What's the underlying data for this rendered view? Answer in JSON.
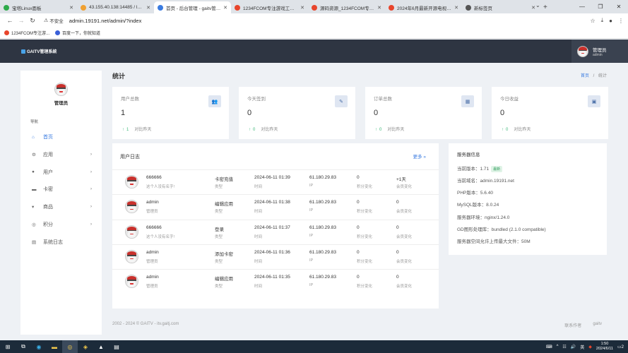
{
  "browser": {
    "tabs": [
      {
        "label": "宝塔Linux面板",
        "color": "#2eaa4a",
        "active": false
      },
      {
        "label": "43.155.40.138:14485 / localh",
        "color": "#f0a030",
        "active": false
      },
      {
        "label": "首页 - 后台管理 - gaitv管理系统",
        "color": "#3a7be0",
        "active": true
      },
      {
        "label": "1234FCOM专注游戏工具及源码",
        "color": "#e8452c",
        "active": false
      },
      {
        "label": "源码资源_1234FCOM专注游戏",
        "color": "#e8452c",
        "active": false
      },
      {
        "label": "2024年6月最新开源电视影视/短",
        "color": "#e8452c",
        "active": false
      },
      {
        "label": "新标签页",
        "color": "#555555",
        "active": false
      }
    ],
    "new_tab": "+",
    "security_label": "不安全",
    "url": "admin.19191.net/admin/?index",
    "bookmarks": [
      {
        "label": "1234FCOM专注游...",
        "color": "#e8452c"
      },
      {
        "label": "百度一下，你就知道",
        "color": "#3a5fd8"
      }
    ]
  },
  "app": {
    "brand": "GAITV管理系统",
    "user": {
      "name": "管理员",
      "role": "admin"
    }
  },
  "sidebar": {
    "name": "管理员",
    "nav_label": "导航",
    "items": [
      {
        "label": "首页",
        "icon": "home-icon",
        "glyph": "⌂",
        "chevron": false,
        "active": true
      },
      {
        "label": "应用",
        "icon": "apps-icon",
        "glyph": "⚙",
        "chevron": true,
        "active": false
      },
      {
        "label": "用户",
        "icon": "user-icon",
        "glyph": "●",
        "chevron": true,
        "active": false
      },
      {
        "label": "卡密",
        "icon": "card-icon",
        "glyph": "▬",
        "chevron": true,
        "active": false
      },
      {
        "label": "商品",
        "icon": "cart-icon",
        "glyph": "▾",
        "chevron": true,
        "active": false
      },
      {
        "label": "积分",
        "icon": "points-icon",
        "glyph": "◎",
        "chevron": true,
        "active": false
      },
      {
        "label": "系统日志",
        "icon": "log-icon",
        "glyph": "▤",
        "chevron": false,
        "active": false
      }
    ]
  },
  "page": {
    "title": "统计",
    "breadcrumb": {
      "home": "首页",
      "sep": "/",
      "current": "统计"
    }
  },
  "stats": [
    {
      "label": "用户总数",
      "value": "1",
      "delta": "1",
      "compare": "对比昨天",
      "icon": "users-icon",
      "glyph": "👥"
    },
    {
      "label": "今天签到",
      "value": "0",
      "delta": "0",
      "compare": "对比昨天",
      "icon": "checkin-icon",
      "glyph": "✎"
    },
    {
      "label": "订单总数",
      "value": "0",
      "delta": "0",
      "compare": "对比昨天",
      "icon": "order-icon",
      "glyph": "▦"
    },
    {
      "label": "今日收益",
      "value": "0",
      "delta": "0",
      "compare": "对比昨天",
      "icon": "income-icon",
      "glyph": "▣"
    }
  ],
  "user_log": {
    "title": "用户日志",
    "more": "更多 »",
    "rows": [
      {
        "user": "666666",
        "sub": "这个人没有名字!",
        "action": "卡密充值",
        "action_sub": "类型",
        "time": "2024-06-11 01:39",
        "time_sub": "时间",
        "ip": "61.180.29.83",
        "ip_sub": "IP",
        "points": "0",
        "points_sub": "积分变化",
        "member": "+1天",
        "member_sub": "会员变化"
      },
      {
        "user": "admin",
        "sub": "管理员",
        "action": "编辑应用",
        "action_sub": "类型",
        "time": "2024-06-11 01:38",
        "time_sub": "时间",
        "ip": "61.180.29.83",
        "ip_sub": "IP",
        "points": "0",
        "points_sub": "积分变化",
        "member": "0",
        "member_sub": "会员变化"
      },
      {
        "user": "666666",
        "sub": "这个人没有名字!",
        "action": "登录",
        "action_sub": "类型",
        "time": "2024-06-11 01:37",
        "time_sub": "时间",
        "ip": "61.180.29.83",
        "ip_sub": "IP",
        "points": "0",
        "points_sub": "积分变化",
        "member": "0",
        "member_sub": "会员变化"
      },
      {
        "user": "admin",
        "sub": "管理员",
        "action": "添加卡密",
        "action_sub": "类型",
        "time": "2024-06-11 01:36",
        "time_sub": "时间",
        "ip": "61.180.29.83",
        "ip_sub": "IP",
        "points": "0",
        "points_sub": "积分变化",
        "member": "0",
        "member_sub": "会员变化"
      },
      {
        "user": "admin",
        "sub": "管理员",
        "action": "编辑应用",
        "action_sub": "类型",
        "time": "2024-06-11 01:35",
        "time_sub": "时间",
        "ip": "61.180.29.83",
        "ip_sub": "IP",
        "points": "0",
        "points_sub": "积分变化",
        "member": "0",
        "member_sub": "会员变化"
      }
    ]
  },
  "server": {
    "title": "服务器信息",
    "version_label": "当前版本：1.71",
    "version_badge": "最新",
    "lines": [
      "当前域名：admin.19191.net",
      "PHP版本：5.6.40",
      "MySQL版本：8.0.24",
      "服务器环境：nginx/1.24.0",
      "GD图形处理库：bundled (2.1.0 compatible)",
      "服务器空间允许上传最大文件：50M"
    ]
  },
  "footer": {
    "copyright": "2002 - 2024 © GAITV - itv.gaitj.com",
    "links": [
      "联系作者",
      "gaitv"
    ]
  },
  "taskbar": {
    "time": "1:50",
    "date": "2024/6/11",
    "lang": "英",
    "notif": "2"
  }
}
